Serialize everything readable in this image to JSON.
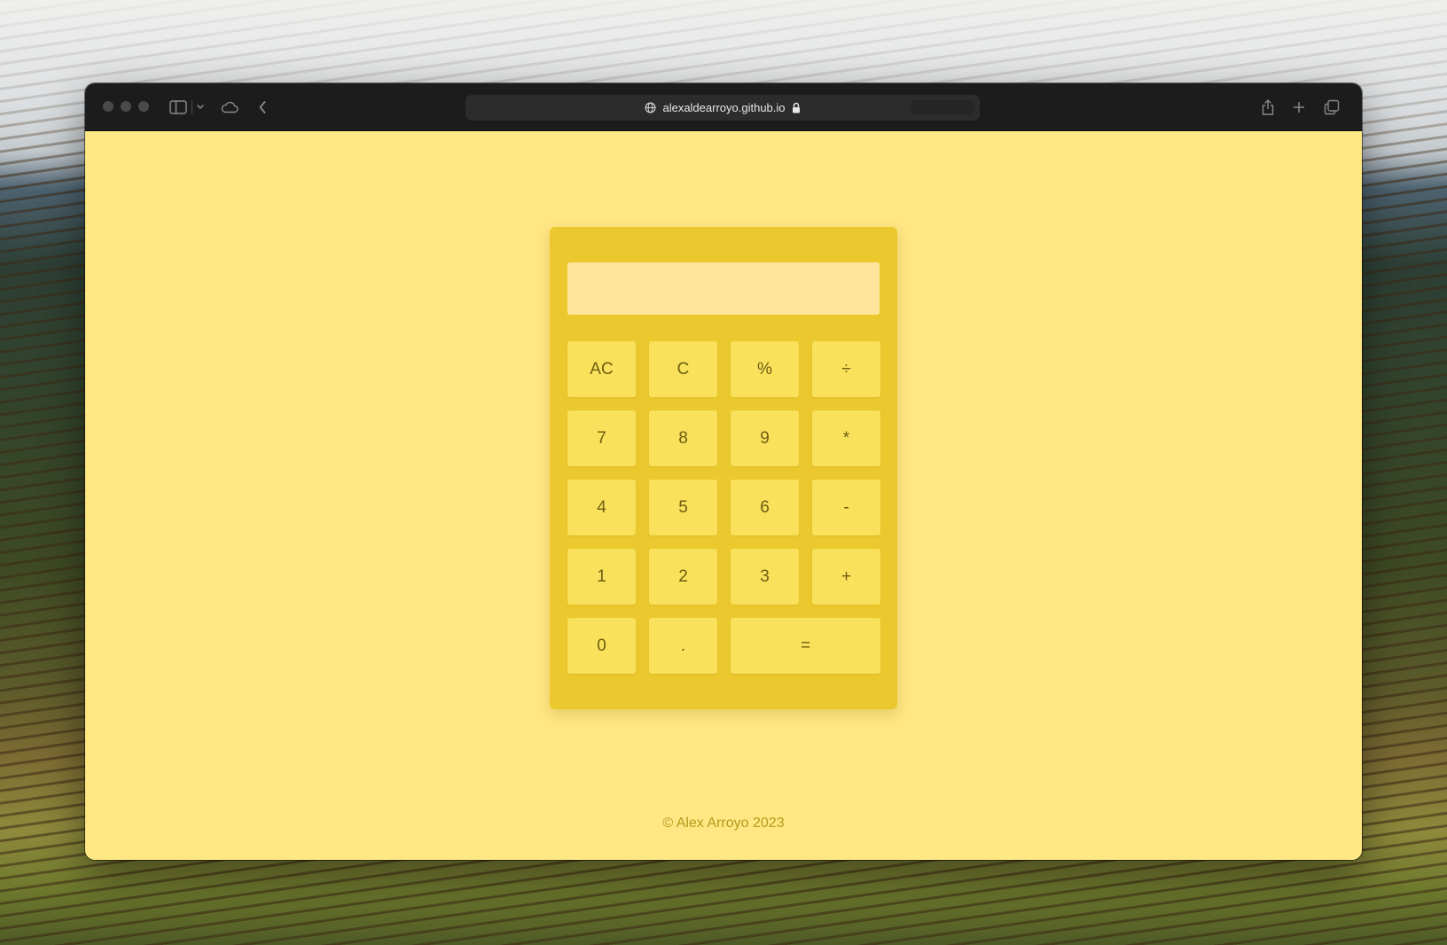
{
  "browser": {
    "url": "alexaldearroyo.github.io",
    "icons": {
      "sidebar": "sidebar-icon",
      "chevron": "chevron-down-icon",
      "cloud": "icloud-tabs-icon",
      "back": "back-arrow-icon",
      "globe": "globe-icon",
      "lock": "lock-icon",
      "share": "share-icon",
      "new_tab": "plus-icon",
      "tabs": "tab-overview-icon"
    }
  },
  "calculator": {
    "display_value": "",
    "keys": {
      "ac": "AC",
      "c": "C",
      "percent": "%",
      "divide": "÷",
      "seven": "7",
      "eight": "8",
      "nine": "9",
      "multiply": "*",
      "four": "4",
      "five": "5",
      "six": "6",
      "minus": "-",
      "one": "1",
      "two": "2",
      "three": "3",
      "plus": "+",
      "zero": "0",
      "dot": ".",
      "equals": "="
    }
  },
  "footer": {
    "text": "© Alex Arroyo 2023"
  },
  "colors": {
    "page_background": "#ffe784",
    "calculator_body": "#ebc92e",
    "key": "#f9e15b",
    "display": "#ffe59c",
    "footer_text": "#b59a1a"
  }
}
